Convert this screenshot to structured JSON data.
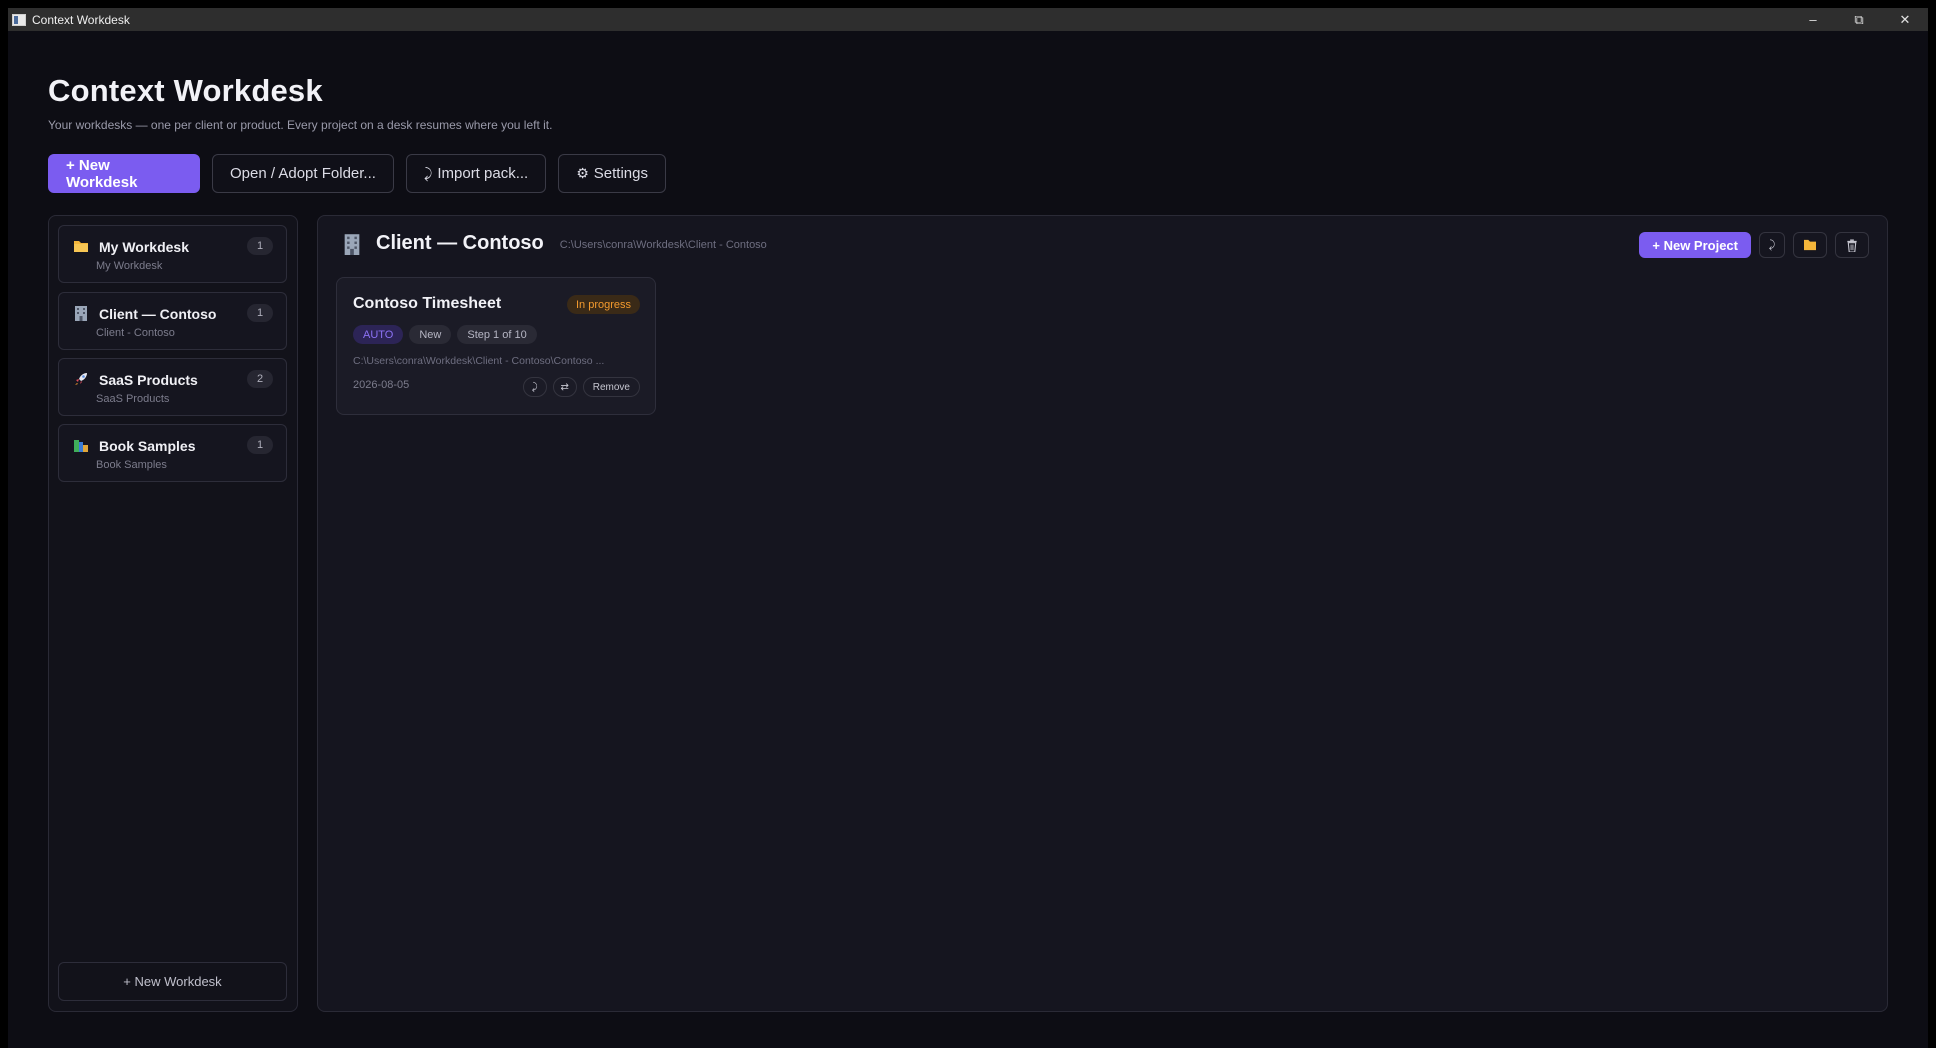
{
  "window": {
    "title": "Context Workdesk",
    "controls": {
      "minimize": "–",
      "restore": "⧉",
      "close": "✕"
    }
  },
  "header": {
    "title": "Context Workdesk",
    "subtitle": "Your workdesks — one per client or product. Every project on a desk resumes where you left it."
  },
  "toolbar": {
    "new_workdesk": "+ New Workdesk",
    "open_folder": "Open / Adopt Folder...",
    "import_icon": "⤸",
    "import_pack": "Import pack...",
    "settings_icon": "⚙",
    "settings": "Settings"
  },
  "sidebar": {
    "items": [
      {
        "name": "My Workdesk",
        "sub": "My Workdesk",
        "count": "1",
        "icon": "folder-icon"
      },
      {
        "name": "Client — Contoso",
        "sub": "Client - Contoso",
        "count": "1",
        "icon": "building-icon"
      },
      {
        "name": "SaaS Products",
        "sub": "SaaS Products",
        "count": "2",
        "icon": "rocket-icon"
      },
      {
        "name": "Book Samples",
        "sub": "Book Samples",
        "count": "1",
        "icon": "books-icon"
      }
    ],
    "new_workdesk": "+ New Workdesk"
  },
  "desk": {
    "title": "Client — Contoso",
    "path": "C:\\Users\\conra\\Workdesk\\Client - Contoso",
    "new_project": "+ New Project",
    "action_icons": [
      "export-icon",
      "folder-icon",
      "trash-icon"
    ]
  },
  "projects": [
    {
      "title": "Contoso Timesheet",
      "status": "In progress",
      "tags": [
        "AUTO",
        "New",
        "Step 1 of 10"
      ],
      "path": "C:\\Users\\conra\\Workdesk\\Client - Contoso\\Contoso ...",
      "date": "2026-08-05",
      "actions": {
        "export": "⤸",
        "move": "⇄",
        "remove": "Remove"
      }
    }
  ],
  "colors": {
    "accent": "#7b5cf0",
    "status_in_progress": "#f39a2e",
    "background": "#0d0d14"
  }
}
